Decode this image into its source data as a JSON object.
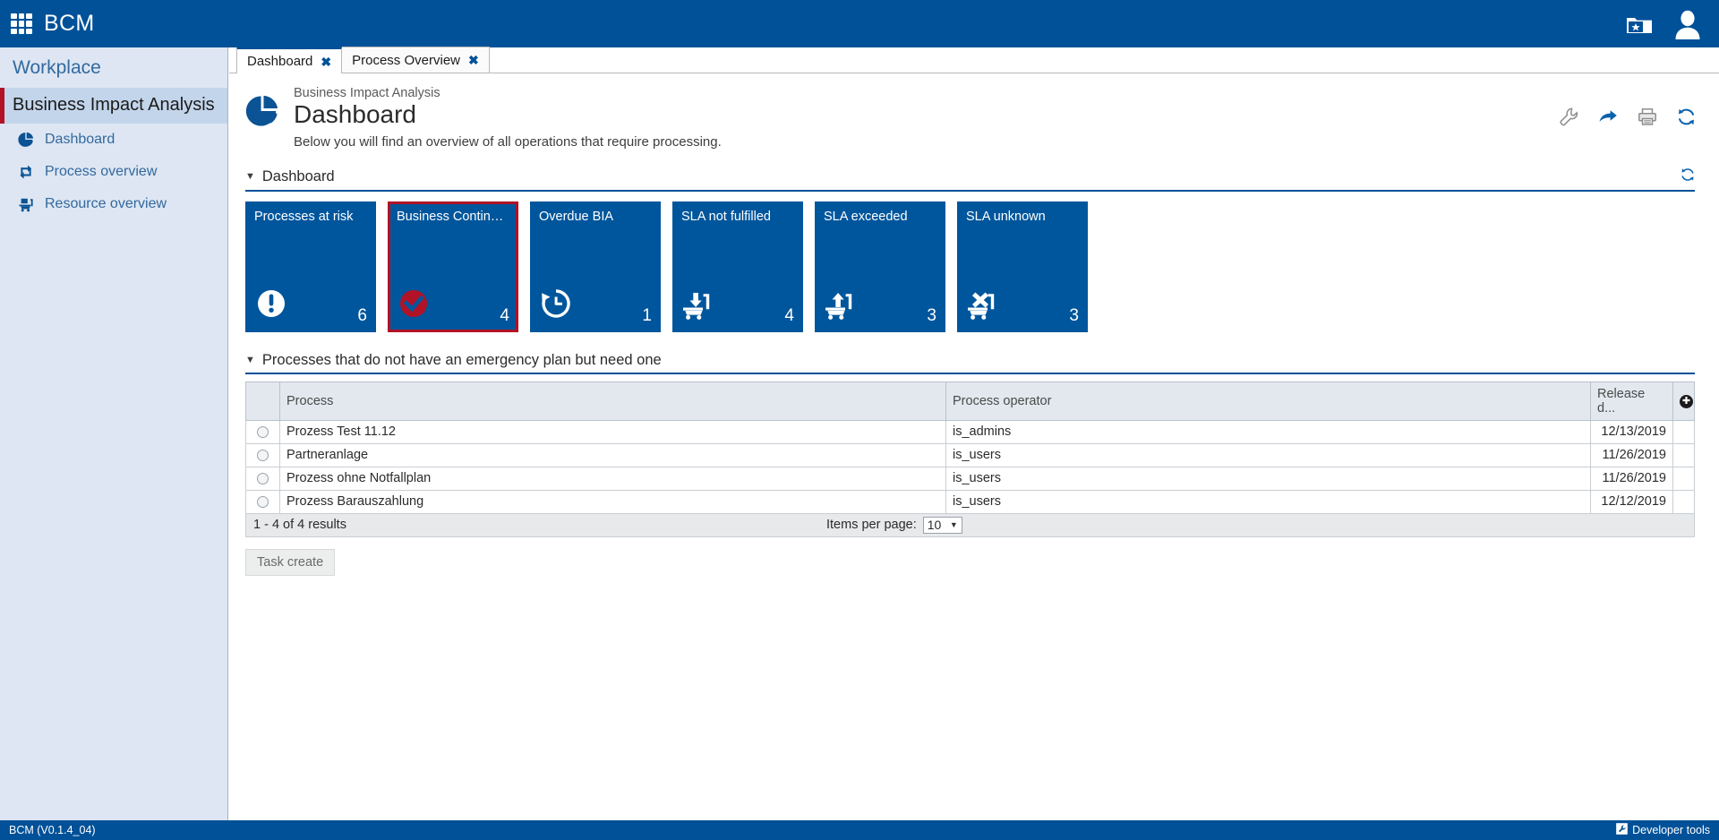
{
  "app": {
    "brand": "BCM",
    "logo_icon": "grid-logo-icon",
    "favorites_icon": "favorites-folder-star-icon",
    "user_icon": "user-avatar-icon"
  },
  "sidebar": {
    "workplace_label": "Workplace",
    "active_section": "Business Impact Analysis",
    "items": [
      {
        "label": "Dashboard",
        "icon": "pie-chart-icon"
      },
      {
        "label": "Process overview",
        "icon": "process-loop-icon"
      },
      {
        "label": "Resource overview",
        "icon": "resource-cart-icon"
      }
    ]
  },
  "tabs": [
    {
      "label": "Dashboard",
      "close": "✖",
      "active": true
    },
    {
      "label": "Process Overview",
      "close": "✖",
      "active": false
    }
  ],
  "page": {
    "breadcrumb": "Business Impact Analysis",
    "title": "Dashboard",
    "subtitle": "Below you will find an overview of all operations that require processing.",
    "icon": "pie-chart-icon"
  },
  "header_tools": [
    {
      "name": "wrench-icon",
      "title": "Settings"
    },
    {
      "name": "share-arrow-icon",
      "title": "Forward"
    },
    {
      "name": "printer-icon",
      "title": "Print"
    },
    {
      "name": "refresh-icon",
      "title": "Refresh"
    }
  ],
  "dashboard_section": {
    "caret": "▼",
    "title": "Dashboard",
    "refresh_icon": "refresh-icon"
  },
  "tiles": [
    {
      "title": "Processes at risk",
      "count": "6",
      "icon": "exclamation-circle-icon",
      "selected": false
    },
    {
      "title": "Business Contingenc...",
      "count": "4",
      "icon": "check-circle-icon",
      "selected": true
    },
    {
      "title": "Overdue BIA",
      "count": "1",
      "icon": "history-clock-icon",
      "selected": false
    },
    {
      "title": "SLA not fulfilled",
      "count": "4",
      "icon": "cart-arrow-down-icon",
      "selected": false
    },
    {
      "title": "SLA exceeded",
      "count": "3",
      "icon": "cart-arrow-up-icon",
      "selected": false
    },
    {
      "title": "SLA unknown",
      "count": "3",
      "icon": "cart-x-icon",
      "selected": false
    }
  ],
  "table_section": {
    "caret": "▼",
    "title": "Processes that do not have an emergency plan but need one",
    "gear_icon": "table-settings-icon",
    "columns": [
      "",
      "Process",
      "Process operator",
      "Release d...",
      ""
    ],
    "rows": [
      {
        "process": "Prozess Test 11.12",
        "operator": "is_admins",
        "release_date": "12/13/2019"
      },
      {
        "process": "Partneranlage",
        "operator": "is_users",
        "release_date": "11/26/2019"
      },
      {
        "process": "Prozess ohne Notfallplan",
        "operator": "is_users",
        "release_date": "11/26/2019"
      },
      {
        "process": "Prozess Barauszahlung",
        "operator": "is_users",
        "release_date": "12/12/2019"
      }
    ],
    "results_text": "1 - 4 of 4 results",
    "items_per_page_label": "Items per page:",
    "items_per_page_value": "10",
    "action_button": "Task create"
  },
  "statusbar": {
    "version": "BCM (V0.1.4_04)",
    "devtools_label": "Developer tools",
    "devtools_icon": "wrench-box-icon"
  },
  "colors": {
    "brand_blue": "#005198",
    "tile_blue": "#00569c",
    "accent_red": "#b11226",
    "sidebar_bg": "#dde6f2",
    "sidebar_active": "#c3d5ea",
    "link_blue": "#33699e"
  }
}
